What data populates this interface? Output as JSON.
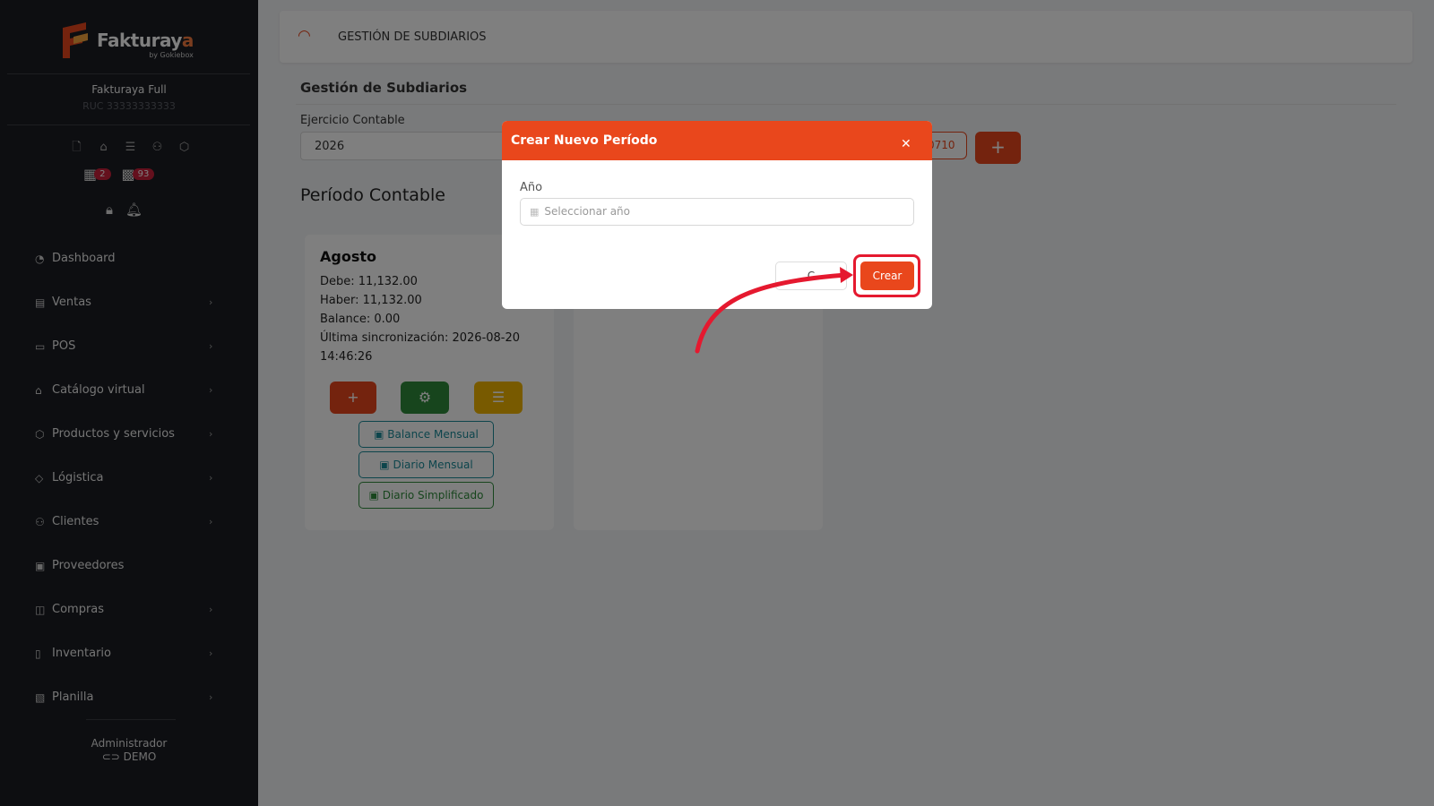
{
  "brand": {
    "name_a": "Fakturay",
    "name_b": "a",
    "by": "by Gokiebox"
  },
  "company": {
    "name": "Fakturaya Full",
    "ruc": "RUC 33333333333"
  },
  "counters": {
    "calendar": "2",
    "boxes": "93"
  },
  "nav": [
    {
      "label": "Dashboard",
      "icon": "dashboard-icon",
      "chevron": false
    },
    {
      "label": "Ventas",
      "icon": "invoice-icon",
      "chevron": true
    },
    {
      "label": "POS",
      "icon": "monitor-icon",
      "chevron": true
    },
    {
      "label": "Catálogo virtual",
      "icon": "store-icon",
      "chevron": true
    },
    {
      "label": "Productos y servicios",
      "icon": "box-icon",
      "chevron": true
    },
    {
      "label": "Lógistica",
      "icon": "tag-icon",
      "chevron": true
    },
    {
      "label": "Clientes",
      "icon": "users-icon",
      "chevron": true
    },
    {
      "label": "Proveedores",
      "icon": "briefcase-icon",
      "chevron": false
    },
    {
      "label": "Compras",
      "icon": "bag-icon",
      "chevron": true
    },
    {
      "label": "Inventario",
      "icon": "book-icon",
      "chevron": true
    },
    {
      "label": "Planilla",
      "icon": "badge-icon",
      "chevron": true
    }
  ],
  "user": {
    "role": "Administrador",
    "name": "DEMO"
  },
  "header": {
    "title": "GESTIÓN DE SUBDIARIOS"
  },
  "page": {
    "heading": "Gestión de Subdiarios",
    "ejercicio_label": "Ejercicio Contable",
    "ejercicio_value": "2026",
    "pill_text": "0710",
    "periodo_heading": "Período Contable"
  },
  "period": {
    "month": "Agosto",
    "debe": "Debe: 11,132.00",
    "haber": "Haber: 11,132.00",
    "balance": "Balance: 0.00",
    "sync_a": "Última sincronización: 2026-08-20",
    "sync_b": "14:46:26",
    "btn_balance": "Balance Mensual",
    "btn_diario": "Diario Mensual",
    "btn_simplificado": "Diario Simplificado"
  },
  "modal": {
    "title": "Crear Nuevo Período",
    "year_label": "Año",
    "year_placeholder": "Seleccionar año",
    "cancel_label": "C",
    "create_label": "Crear"
  },
  "colors": {
    "accent": "#e9471c",
    "sidebar": "#1b1d23",
    "green": "#2e8b3a",
    "yellow": "#f0b400",
    "teal": "#1a8a99"
  }
}
